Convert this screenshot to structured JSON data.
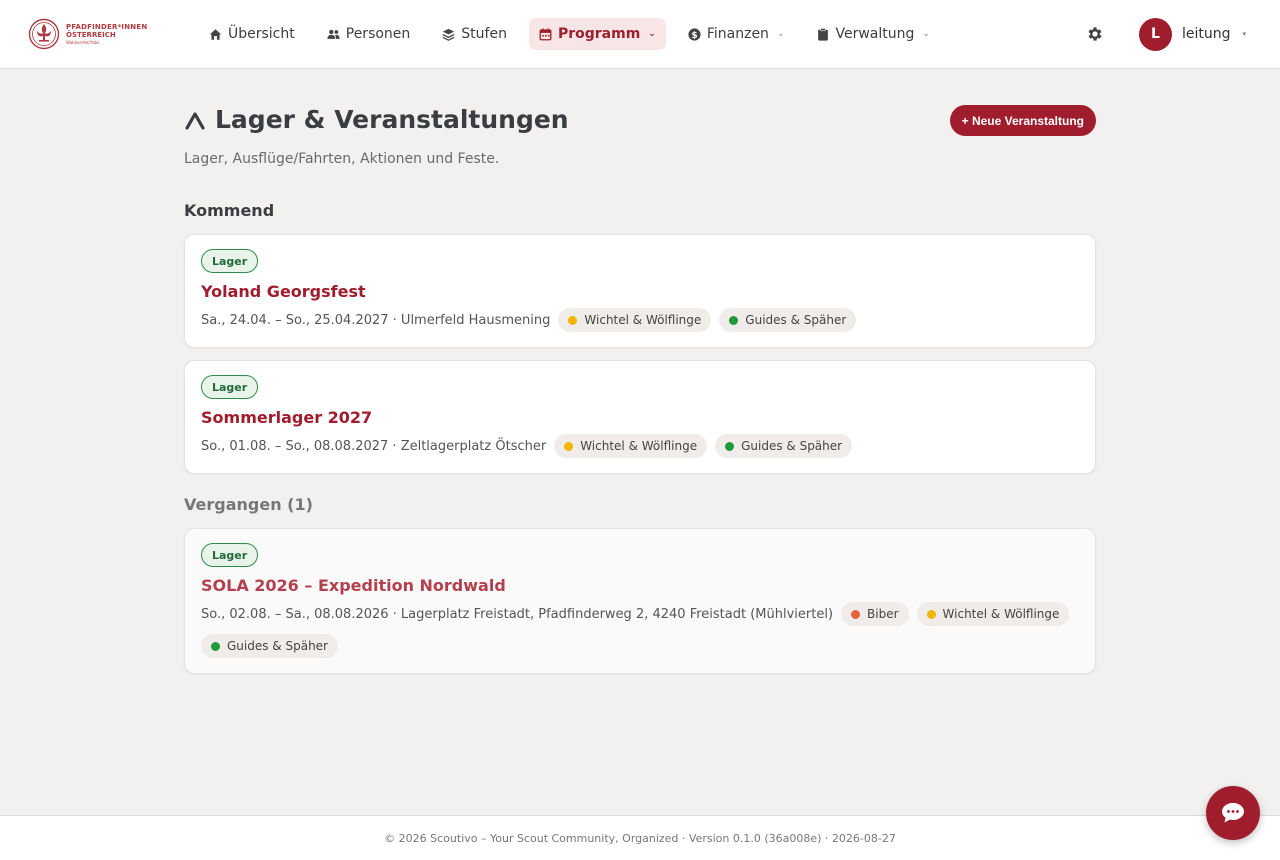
{
  "brand": {
    "line1": "PFADFINDER*INNEN",
    "line2": "ÖSTERREICH",
    "line3": "Waldviertel/Ybbs"
  },
  "nav": {
    "items": [
      {
        "label": "Übersicht",
        "icon": "home-icon"
      },
      {
        "label": "Personen",
        "icon": "people-icon"
      },
      {
        "label": "Stufen",
        "icon": "layers-icon"
      },
      {
        "label": "Programm",
        "icon": "calendar-icon",
        "active": true,
        "dropdown": true
      },
      {
        "label": "Finanzen",
        "icon": "dollar-icon",
        "dropdown": true
      },
      {
        "label": "Verwaltung",
        "icon": "clipboard-icon",
        "dropdown": true
      }
    ]
  },
  "user": {
    "initial": "L",
    "name": "leitung",
    "caret": "▾"
  },
  "page": {
    "title": "Lager & Veranstaltungen",
    "subtitle": "Lager, Ausflüge/Fahrten, Aktionen und Feste.",
    "new_button": "+ Neue Veranstaltung"
  },
  "sections": {
    "upcoming_title": "Kommend",
    "past_title": "Vergangen (1)"
  },
  "upcoming": [
    {
      "tag": "Lager",
      "title": "Yoland Georgsfest",
      "meta": "Sa., 24.04. – So., 25.04.2027  · Ulmerfeld Hausmening",
      "groups": [
        {
          "name": "Wichtel & Wölflinge",
          "color": "#f4b400"
        },
        {
          "name": "Guides & Späher",
          "color": "#1e9a3a"
        }
      ]
    },
    {
      "tag": "Lager",
      "title": "Sommerlager 2027",
      "meta": "So., 01.08. – So., 08.08.2027  · Zeltlagerplatz Ötscher",
      "groups": [
        {
          "name": "Wichtel & Wölflinge",
          "color": "#f4b400"
        },
        {
          "name": "Guides & Späher",
          "color": "#1e9a3a"
        }
      ]
    }
  ],
  "past": [
    {
      "tag": "Lager",
      "title": "SOLA 2026 – Expedition Nordwald",
      "meta": "So., 02.08. – Sa., 08.08.2026  · Lagerplatz Freistadt, Pfadfinderweg 2, 4240 Freistadt (Mühlviertel)",
      "groups": [
        {
          "name": "Biber",
          "color": "#e8603c"
        },
        {
          "name": "Wichtel & Wölflinge",
          "color": "#f4b400"
        },
        {
          "name": "Guides & Späher",
          "color": "#1e9a3a"
        }
      ]
    }
  ],
  "footer": {
    "text": "© 2026 Scoutivo – Your Scout Community, Organized · Version 0.1.0 (36a008e) · 2026-08-27"
  },
  "colors": {
    "accent": "#a01d2d",
    "active_bg": "#f8e5e6",
    "tag_green": "#2e8b4b"
  }
}
